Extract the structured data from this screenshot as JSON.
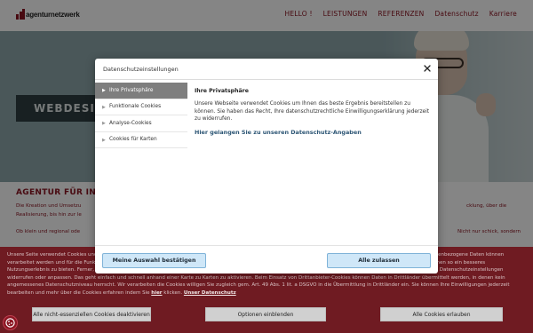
{
  "header": {
    "logo_text": "agenturnetzwerk",
    "nav": [
      "HELLO !",
      "LEISTUNGEN",
      "REFERENZEN",
      "Datenschutz",
      "Karriere"
    ]
  },
  "hero": {
    "banner_text": "WEBDESI"
  },
  "page": {
    "heading": "AGENTUR FÜR IN",
    "line1": "Die Kreation und Umsetzu",
    "line1_right": "cklung, über die",
    "line2": "Realisierung, bis hin zur le",
    "line3": "Ob klein und regional ode",
    "line3_right": "Nicht nur schick, sondern"
  },
  "cookie_bar": {
    "text": "Unsere Seite verwendet Cookies und ähnliche Technologien. Einige davon sind essenziell, während andere uns helfen, diese Webseite und Ihre Erfahrung zu verbessern. Personenbezogene Daten können verarbeitet werden und für die Funktionalität der Seite sorgen, wie z. B. Ihre Sprachauswahl. Wir nutzen Analyse-Cookies, um die Nutzung unserer Website auszuwerten und Ihnen so ein besseres Nutzungserlebnis zu bieten. Ferner, damit wir unser Angebot optimieren und Ihnen die für Sie relevanten Inhalte anzeigen können. Sie können Ihre Einwilligung jederzeit in den Datenschutzeinstellungen widerrufen oder anpassen. Das geht einfach und schnell anhand einer Karte zu Karten zu aktivieren. Beim Einsatz von Drittanbieter-Cookies können Daten in Drittländer übermittelt werden, in denen kein angemessenes Datenschutzniveau herrscht. Wir verarbeiten die Cookies willigen Sie zugleich gem. Art. 49 Abs. 1 lit. a DSGVO in die Übermittlung in Drittländer ein. Sie können Ihre Einwilligungen jederzeit bearbeiten und mehr über die Cookies erfahren indem Sie",
    "link_here": "hier",
    "after_link": "klicken.",
    "link_privacy": "Unser Datenschutz",
    "btn_deactivate": "Alle nicht-essenziellen Cookies deaktivieren",
    "btn_options": "Optionen einblenden",
    "btn_allow": "Alle Cookies erlauben"
  },
  "modal": {
    "title": "Datenschutzeinstellungen",
    "sidebar": [
      {
        "label": "Ihre Privatsphäre",
        "active": true
      },
      {
        "label": "Funktionale Cookies",
        "active": false
      },
      {
        "label": "Analyse-Cookies",
        "active": false
      },
      {
        "label": "Cookies für Karten",
        "active": false
      }
    ],
    "content_title": "Ihre Privatsphäre",
    "content_text": "Unsere Webseite verwendet Cookies um Ihnen das beste Ergebnis bereitstellen zu können. Sie haben das Recht, Ihre datenschutzrechtliche Einwilligungserklärung jederzeit zu widerrufen.",
    "content_link": "Hier gelangen Sie zu unseren Datenschutz-Angaben",
    "btn_confirm": "Meine Auswahl bestätigen",
    "btn_allow_all": "Alle zulassen"
  },
  "colors": {
    "brand": "#8b1522",
    "cookie_bar": "#6f1b22",
    "modal_button": "#cfe7f8",
    "sidebar_active": "#7e7e7e"
  },
  "icons": {
    "close": "close-icon",
    "cookie_settings": "cookie-icon",
    "sidebar_arrow": "chevron-right-icon"
  }
}
